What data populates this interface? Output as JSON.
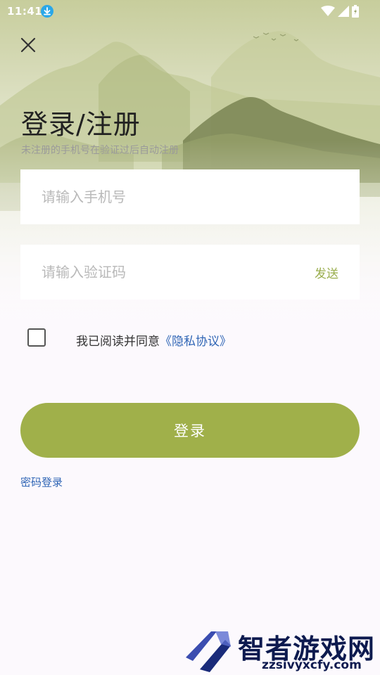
{
  "status_bar": {
    "time": "11:41",
    "icons": [
      "download-icon",
      "wifi-icon",
      "signal-icon",
      "battery-icon"
    ]
  },
  "header": {
    "close_icon": "close-icon",
    "title": "登录/注册",
    "subtitle": "未注册的手机号在验证过后自动注册"
  },
  "form": {
    "phone_placeholder": "请输入手机号",
    "code_placeholder": "请输入验证码",
    "send_label": "发送",
    "agree_text": "我已阅读并同意",
    "privacy_link": "《隐私协议》",
    "login_label": "登录",
    "password_login_label": "密码登录"
  },
  "watermark": {
    "brand": "智者游戏网",
    "url": "zzsivyxcfy.com"
  },
  "colors": {
    "accent": "#a0b04a",
    "link": "#2f65b5",
    "send": "#9aae4e"
  }
}
